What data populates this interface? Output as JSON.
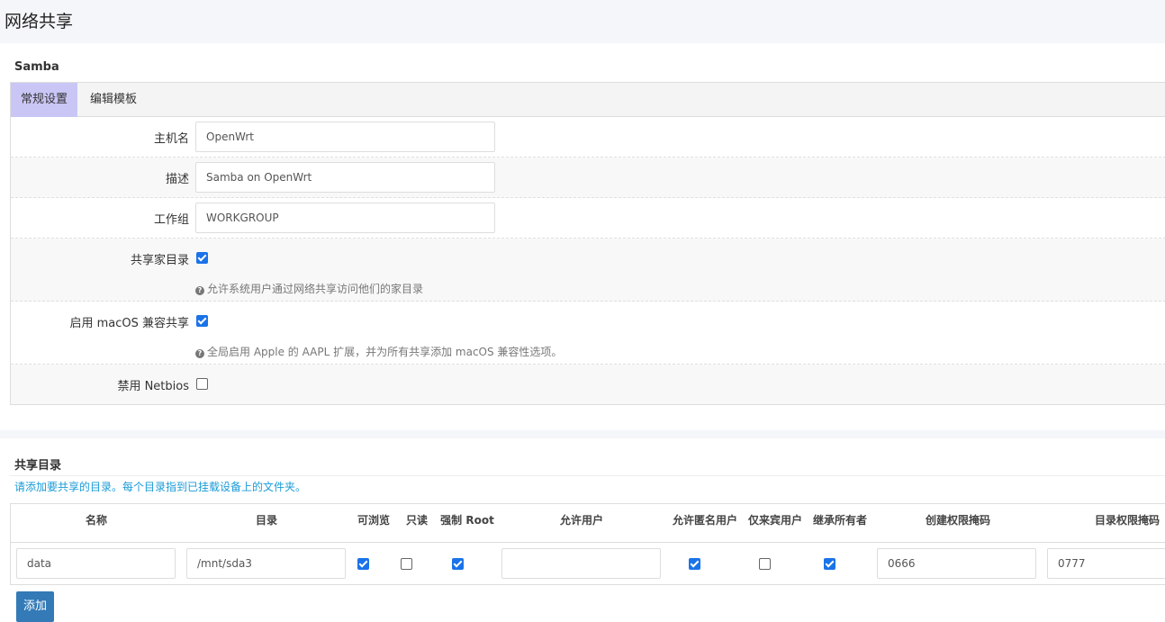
{
  "page": {
    "title": "网络共享"
  },
  "samba": {
    "title": "Samba",
    "tabs": [
      {
        "label": "常规设置",
        "active": true
      },
      {
        "label": "编辑模板",
        "active": false
      }
    ],
    "fields": {
      "hostname": {
        "label": "主机名",
        "value": "OpenWrt"
      },
      "description": {
        "label": "描述",
        "value": "Samba on OpenWrt"
      },
      "workgroup": {
        "label": "工作组",
        "value": "WORKGROUP"
      },
      "share_home": {
        "label": "共享家目录",
        "checked": true,
        "hint": "允许系统用户通过网络共享访问他们的家目录"
      },
      "macos": {
        "label": "启用 macOS 兼容共享",
        "checked": true,
        "hint": "全局启用 Apple 的 AAPL 扩展，并为所有共享添加 macOS 兼容性选项。"
      },
      "netbios": {
        "label": "禁用 Netbios",
        "checked": false
      }
    }
  },
  "shares": {
    "title": "共享目录",
    "description": "请添加要共享的目录。每个目录指到已挂载设备上的文件夹。",
    "columns": [
      "名称",
      "目录",
      "可浏览",
      "只读",
      "强制 Root",
      "允许用户",
      "允许匿名用户",
      "仅来宾用户",
      "继承所有者",
      "创建权限掩码",
      "目录权限掩码"
    ],
    "rows": [
      {
        "name": "data",
        "path": "/mnt/sda3",
        "browseable": true,
        "read_only": false,
        "force_root": true,
        "users": "",
        "guest_ok": true,
        "guest_only": false,
        "inherit_owner": true,
        "create_mask": "0666",
        "dir_mask": "0777"
      }
    ],
    "add_label": "添加"
  },
  "colors": {
    "accent": "#1a73e8",
    "tab_active": "#c9c6f6",
    "button": "#337ab7",
    "desc_text": "#1a9bd7"
  }
}
